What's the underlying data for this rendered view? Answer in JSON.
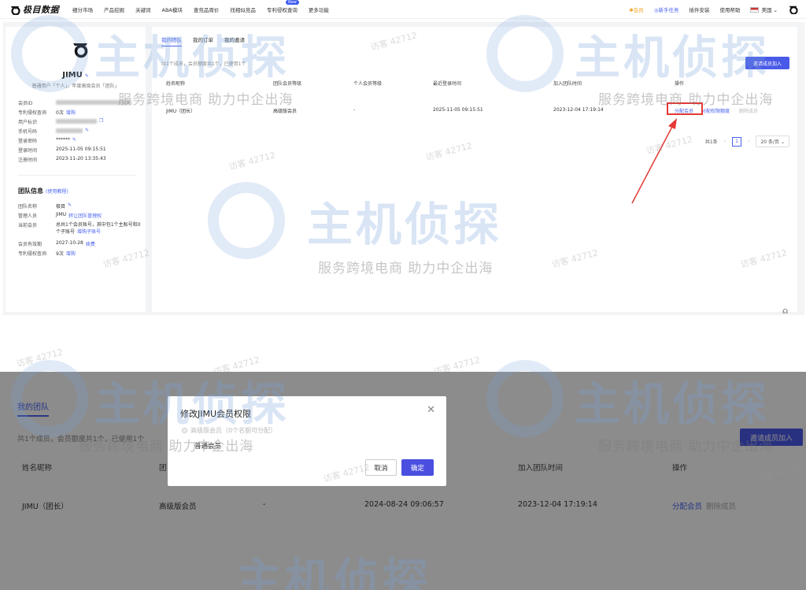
{
  "topbar": {
    "logo_text": "极目数据",
    "nav": [
      "细分市场",
      "产品挖掘",
      "关键词",
      "ABA模块",
      "查竞品周价",
      "找相似竞品",
      "专利侵权查询",
      "更多功能"
    ],
    "nav_badge": "New",
    "right": {
      "member": "✱会员",
      "task": "◎新手任务",
      "plugin": "插件安装",
      "help": "使用帮助",
      "region": "美国"
    }
  },
  "sidebar": {
    "username": "JIMU",
    "subtitle": "普通用户「个人」，年度高级会员「团队」",
    "fields": [
      {
        "key": "会员ID",
        "value": "",
        "link": ""
      },
      {
        "key": "专利侵权查询",
        "value": "0次",
        "link": "增购"
      },
      {
        "key": "用户标识",
        "value": "",
        "link": ""
      },
      {
        "key": "手机号码",
        "value": "",
        "link": ""
      },
      {
        "key": "登录密码",
        "value": "******",
        "link": ""
      },
      {
        "key": "登录时间",
        "value": "2025-11-05 09:15:51",
        "link": ""
      },
      {
        "key": "注册时间",
        "value": "2023-11-20 13:35:43",
        "link": ""
      }
    ],
    "team_heading": "团队信息",
    "team_tutorial": "(使用教程)",
    "team_fields": [
      {
        "key": "团队名称",
        "value": "极目",
        "link": ""
      },
      {
        "key": "管理人员",
        "value": "JIMU",
        "link": "转让团队管理权"
      },
      {
        "key": "当前会员",
        "value": "总共1个会员账号，其中包1个主账号和0个子账号",
        "link": "增购子账号"
      },
      {
        "key": "会员有效期",
        "value": "2027-10-28",
        "link": "续费"
      },
      {
        "key": "专利侵权查询",
        "value": "9次",
        "link": "增购"
      }
    ]
  },
  "main": {
    "tabs": [
      "我的团队",
      "我的订单",
      "我的邀请"
    ],
    "summary": "共1个成员，会员额度共1个，已使用1个",
    "invite_button": "邀请成员加入",
    "columns": [
      "姓名昵称",
      "团队会员等级",
      "个人会员等级",
      "最近登录时间",
      "加入团队时间",
      "操作"
    ],
    "rows": [
      {
        "name": "JIMU（团长）",
        "team_level": "高级版会员",
        "personal_level": "-",
        "last_login": "2025-11-05 09:15:51",
        "joined": "2023-12-04 17:19:14",
        "op_assign": "分配会员",
        "op_perm": "分配权限额度",
        "op_remove": "删除成员"
      }
    ],
    "pager": {
      "total": "共1条",
      "current": "1",
      "size": "20 条/页"
    }
  },
  "watermark": {
    "brand": "主机侦探",
    "slogan": "服务跨境电商 助力中企出海",
    "visitor": "访客 42712"
  },
  "bottom": {
    "tab": "我的团队",
    "summary": "共1个成员，会员额度共1个，已使用1个",
    "invite_button": "邀请成员加入",
    "columns": [
      "姓名昵称",
      "团",
      "加入团队时间",
      "操作"
    ],
    "row": {
      "name": "JIMU（团长）",
      "team_level": "高级版会员",
      "personal_level": "-",
      "last_login": "2024-08-24 09:06:57",
      "joined": "2023-12-04 17:19:14",
      "op_assign": "分配会员",
      "op_remove": "删除成员"
    },
    "modal": {
      "title": "修改JIMU会员权限",
      "option_disabled": "高级版会员（0个名额可分配）",
      "option_normal": "普通会员",
      "cancel": "取消",
      "confirm": "确定"
    }
  },
  "colors": {
    "accent": "#4a63f0",
    "highlight": "#e53935",
    "member": "#f29f1c"
  }
}
